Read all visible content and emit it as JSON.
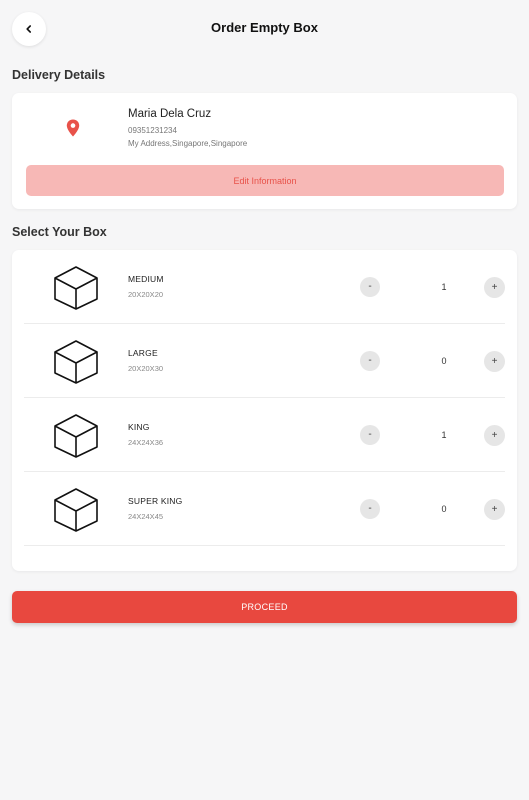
{
  "header": {
    "title": "Order Empty Box",
    "back_icon": "chevron-left-icon"
  },
  "delivery": {
    "section_title": "Delivery Details",
    "icon": "location-pin-icon",
    "icon_color": "#e8524a",
    "name": "Maria Dela Cruz",
    "phone": "09351231234",
    "address": "My Address,Singapore,Singapore",
    "edit_label": "Edit Information"
  },
  "boxes": {
    "section_title": "Select Your Box",
    "items": [
      {
        "name": "MEDIUM",
        "dims": "20X20X20",
        "qty": "1",
        "minus": "-",
        "plus": "+"
      },
      {
        "name": "LARGE",
        "dims": "20X20X30",
        "qty": "0",
        "minus": "-",
        "plus": "+"
      },
      {
        "name": "KING",
        "dims": "24X24X36",
        "qty": "1",
        "minus": "-",
        "plus": "+"
      },
      {
        "name": "SUPER KING",
        "dims": "24X24X45",
        "qty": "0",
        "minus": "-",
        "plus": "+"
      }
    ]
  },
  "proceed_label": "PROCEED",
  "colors": {
    "accent": "#e8483f",
    "edit_button_bg": "#f7b8b6",
    "background": "#f6f6f7"
  }
}
